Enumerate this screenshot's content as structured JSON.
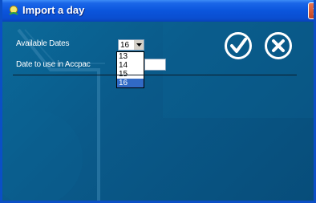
{
  "window": {
    "title": "Import a day"
  },
  "form": {
    "available_dates_label": "Available Dates",
    "date_to_use_label": "Date to use in Accpac",
    "selected_date": "16",
    "date_options": [
      "13",
      "14",
      "15",
      "16"
    ],
    "date_to_use_value": ""
  },
  "colors": {
    "titlebar": "#0b55dc",
    "client_bg": "#0a5785",
    "selection": "#316ac5"
  },
  "icons": {
    "title": "app-icon",
    "close": "close-x-icon",
    "ok": "checkmark-icon",
    "cancel": "x-icon"
  }
}
